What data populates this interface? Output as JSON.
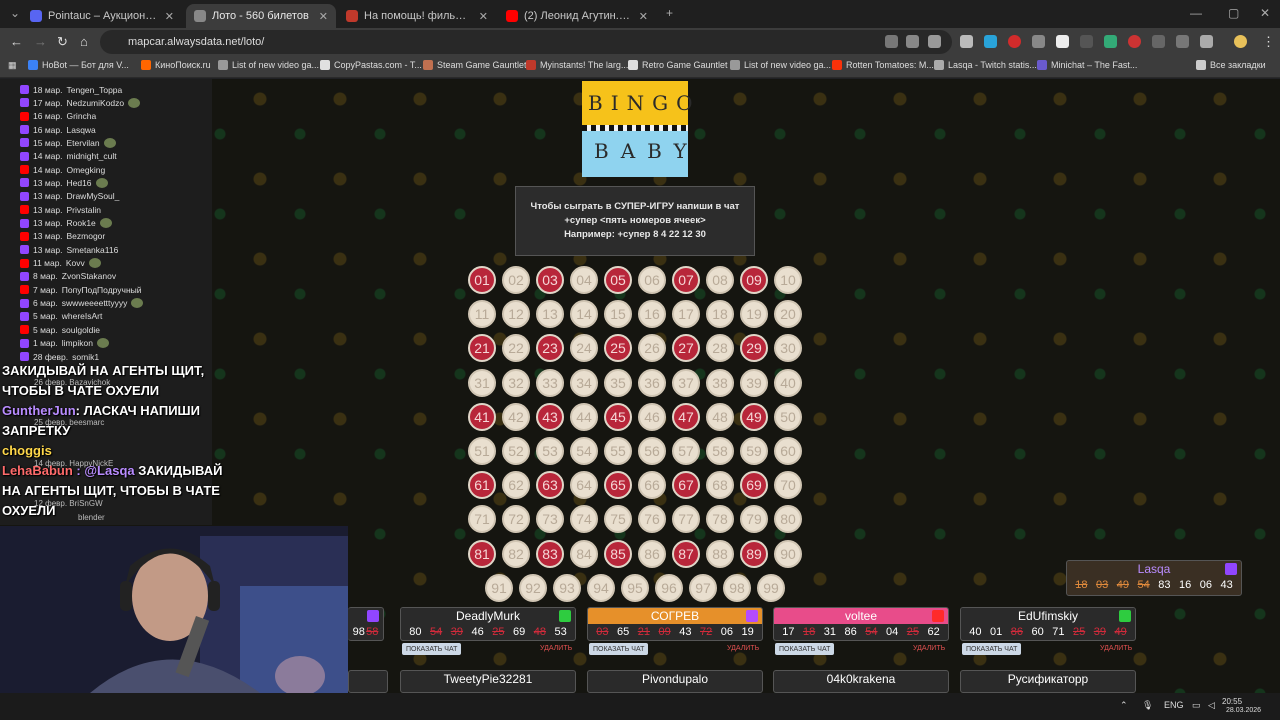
{
  "tabs": [
    {
      "label": "Pointauc – Аукционы, лотереи и...",
      "active": false,
      "color": "#5865f2"
    },
    {
      "label": "Лото - 560 билетов",
      "active": true,
      "color": "#888888"
    },
    {
      "label": "На помощь! фильм, 2025, дат...",
      "active": false,
      "color": "#c0392b"
    },
    {
      "label": "(2) Леонид Агутин.Остров - Yo...",
      "active": false,
      "color": "#ff0000"
    }
  ],
  "url": "mapcar.alwaysdata.net/loto/",
  "bookmarks": [
    {
      "label": "НоBot — Бот для V...",
      "color": "#3b82f6"
    },
    {
      "label": "КиноПоиск.ru",
      "color": "#ff6600"
    },
    {
      "label": "List of new video ga...",
      "color": "#999999"
    },
    {
      "label": "CopyPastas.com - T...",
      "color": "#e0e0e0"
    },
    {
      "label": "Steam Game Gauntlet",
      "color": "#c07050"
    },
    {
      "label": "Myinstants! The larg...",
      "color": "#c0392b"
    },
    {
      "label": "Retro Game Gauntlet",
      "color": "#dddddd"
    },
    {
      "label": "List of new video ga...",
      "color": "#999999"
    },
    {
      "label": "Rotten Tomatoes: M...",
      "color": "#fa320a"
    },
    {
      "label": "Lasqa - Twitch statis...",
      "color": "#aaaaaa"
    },
    {
      "label": "Minichat – The Fast...",
      "color": "#6a5acd"
    },
    {
      "label": "Все закладки",
      "color": "#cccccc"
    }
  ],
  "sidebar_entries": [
    {
      "date": "18 мар.",
      "name": "Tengen_Toppa",
      "src": "tw"
    },
    {
      "date": "17 мар.",
      "name": "NedzumiKodzo",
      "src": "tw"
    },
    {
      "date": "16 мар.",
      "name": "Grincha",
      "src": "yt"
    },
    {
      "date": "16 мар.",
      "name": "Lasqwa",
      "src": "tw"
    },
    {
      "date": "15 мар.",
      "name": "Etervilan",
      "src": "tw"
    },
    {
      "date": "14 мар.",
      "name": "midnight_cult",
      "src": "tw"
    },
    {
      "date": "14 мар.",
      "name": "Omegking",
      "src": "yt"
    },
    {
      "date": "13 мар.",
      "name": "Hed16",
      "src": "tw"
    },
    {
      "date": "13 мар.",
      "name": "DrawMySoul_",
      "src": "tw"
    },
    {
      "date": "13 мар.",
      "name": "Privstalin",
      "src": "yt"
    },
    {
      "date": "13 мар.",
      "name": "Rook1e",
      "src": "tw"
    },
    {
      "date": "13 мар.",
      "name": "Bezmogor",
      "src": "yt"
    },
    {
      "date": "13 мар.",
      "name": "Smetanka116",
      "src": "tw"
    },
    {
      "date": "11 мар.",
      "name": "Kovv",
      "src": "yt"
    },
    {
      "date": "8 мар.",
      "name": "ZvonStakanov",
      "src": "tw"
    },
    {
      "date": "7 мар.",
      "name": "ПопуПодПодручный",
      "src": "yt"
    },
    {
      "date": "6 мар.",
      "name": "swwweeeetttyyyy",
      "src": "tw"
    },
    {
      "date": "5 мар.",
      "name": "whereIsArt",
      "src": "tw"
    },
    {
      "date": "5 мар.",
      "name": "soulgoldie",
      "src": "yt"
    },
    {
      "date": "1 мар.",
      "name": "limpikon",
      "src": "tw"
    },
    {
      "date": "28 февр.",
      "name": "somik1",
      "src": "tw"
    }
  ],
  "chat_overlay": {
    "line1": "ЗАКИДЫВАЙ НА АГЕНТЫ ЩИТ,",
    "line2": "ЧТОБЫ В ЧАТЕ ОХУЕЛИ",
    "nick1": "GuntherJun",
    "line3": ": ЛАСКАЧ НАПИШИ",
    "line4": "ЗАПРЕТКУ",
    "nick2": "choggis",
    "nick3": "LehaBabun",
    "line5": ": @Lasqa",
    "line6": "ЗАКИДЫВАЙ",
    "line7": "НА АГЕНТЫ ЩИТ, ЧТОБЫ В ЧАТЕ",
    "line8": "ОХУЕЛИ",
    "under1": "26 февр. Bazavichok",
    "under2": "25 февр. beesmarc",
    "under3": "14 февр. HappyNickE",
    "under4": "12 февр. BriSnGW",
    "under5": "blender"
  },
  "logo": {
    "top": "BINGO",
    "bottom": "BABY"
  },
  "info": {
    "line1": "Чтобы сыграть в СУПЕР-ИГРУ напиши в чат",
    "line2": "+супер <пять номеров ячеек>",
    "line3": "Например: +супер 8 4 22 12 30"
  },
  "balls": {
    "picked": [
      "01",
      "03",
      "05",
      "07",
      "09",
      "21",
      "23",
      "25",
      "27",
      "29",
      "41",
      "43",
      "45",
      "47",
      "49",
      "61",
      "63",
      "65",
      "67",
      "69",
      "81",
      "83",
      "85",
      "87",
      "89"
    ],
    "rows": [
      [
        "01",
        "02",
        "03",
        "04",
        "05",
        "06",
        "07",
        "08",
        "09",
        "10"
      ],
      [
        "11",
        "12",
        "13",
        "14",
        "15",
        "16",
        "17",
        "18",
        "19",
        "20"
      ],
      [
        "21",
        "22",
        "23",
        "24",
        "25",
        "26",
        "27",
        "28",
        "29",
        "30"
      ],
      [
        "31",
        "32",
        "33",
        "34",
        "35",
        "36",
        "37",
        "38",
        "39",
        "40"
      ],
      [
        "41",
        "42",
        "43",
        "44",
        "45",
        "46",
        "47",
        "48",
        "49",
        "50"
      ],
      [
        "51",
        "52",
        "53",
        "54",
        "55",
        "56",
        "57",
        "58",
        "59",
        "60"
      ],
      [
        "61",
        "62",
        "63",
        "64",
        "65",
        "66",
        "67",
        "68",
        "69",
        "70"
      ],
      [
        "71",
        "72",
        "73",
        "74",
        "75",
        "76",
        "77",
        "78",
        "79",
        "80"
      ],
      [
        "81",
        "82",
        "83",
        "84",
        "85",
        "86",
        "87",
        "88",
        "89",
        "90"
      ],
      [
        "91",
        "92",
        "93",
        "94",
        "95",
        "96",
        "97",
        "98",
        "99"
      ]
    ]
  },
  "cards": [
    {
      "name": "",
      "nums": [
        [
          "98",
          false
        ],
        [
          "58",
          true
        ]
      ],
      "partial": true
    },
    {
      "name": "DeadlyMurk",
      "nums": [
        [
          "80",
          false
        ],
        [
          "54",
          true
        ],
        [
          "39",
          true
        ],
        [
          "46",
          false
        ],
        [
          "25",
          true
        ],
        [
          "69",
          false
        ],
        [
          "48",
          true
        ],
        [
          "53",
          false
        ]
      ],
      "show": "ПОКАЗАТЬ ЧАТ",
      "del": "УДАЛИТЬ",
      "head_color": "#2a2a2a",
      "badge": "#2ecc40"
    },
    {
      "name": "СОГРЕВ",
      "nums": [
        [
          "03",
          true
        ],
        [
          "65",
          false
        ],
        [
          "21",
          true
        ],
        [
          "09",
          true
        ],
        [
          "43",
          false
        ],
        [
          "72",
          true
        ],
        [
          "06",
          false
        ],
        [
          "19",
          false
        ]
      ],
      "show": "ПОКАЗАТЬ ЧАТ",
      "del": "УДАЛИТЬ",
      "head_color": "#e6902a",
      "badge": "#b44bff"
    },
    {
      "name": "voltee",
      "nums": [
        [
          "17",
          false
        ],
        [
          "18",
          true
        ],
        [
          "31",
          false
        ],
        [
          "86",
          false
        ],
        [
          "54",
          true
        ],
        [
          "04",
          false
        ],
        [
          "25",
          true
        ],
        [
          "62",
          false
        ]
      ],
      "show": "ПОКАЗАТЬ ЧАТ",
      "del": "УДАЛИТЬ",
      "head_color": "#e84c8a",
      "badge": "#ff2a2a"
    },
    {
      "name": "EdUfimskiy",
      "nums": [
        [
          "40",
          false
        ],
        [
          "01",
          false
        ],
        [
          "86",
          true
        ],
        [
          "60",
          false
        ],
        [
          "71",
          false
        ],
        [
          "25",
          true
        ],
        [
          "39",
          true
        ],
        [
          "49",
          true
        ]
      ],
      "show": "ПОКАЗАТЬ ЧАТ",
      "del": "УДАЛИТЬ",
      "head_color": "#2a2a2a",
      "badge": "#2ecc40"
    }
  ],
  "lower_cards": [
    "TweetyPie32281",
    "Pivondupalo",
    "04k0krakena",
    "Русификаторр"
  ],
  "lasqa_card": {
    "name": "Lasqa",
    "nums": [
      [
        "18",
        true
      ],
      [
        "03",
        true
      ],
      [
        "49",
        true
      ],
      [
        "54",
        true
      ],
      [
        "83",
        false
      ],
      [
        "16",
        false
      ],
      [
        "06",
        false
      ],
      [
        "43",
        false
      ]
    ]
  },
  "tray": {
    "lang": "ENG",
    "time": "20:55",
    "date": "28.03.2026"
  }
}
